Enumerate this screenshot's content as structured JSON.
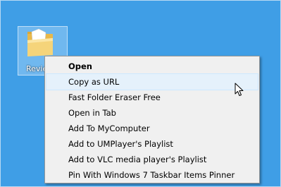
{
  "desktop": {
    "background_color": "#3f9ee6",
    "folder": {
      "icon": "folder-icon",
      "label": "Revie"
    }
  },
  "context_menu": {
    "items": [
      {
        "label": "Open",
        "bold": true
      },
      {
        "label": "Copy as URL",
        "highlighted": true
      },
      {
        "label": "Fast Folder Eraser Free"
      },
      {
        "label": "Open in Tab"
      },
      {
        "label": "Add To MyComputer"
      },
      {
        "label": "Add to UMPlayer's Playlist"
      },
      {
        "label": "Add to VLC media player's Playlist"
      },
      {
        "label": "Pin With Windows 7 Taskbar Items Pinner"
      }
    ]
  },
  "cursor": {
    "icon": "mouse-pointer-icon"
  }
}
